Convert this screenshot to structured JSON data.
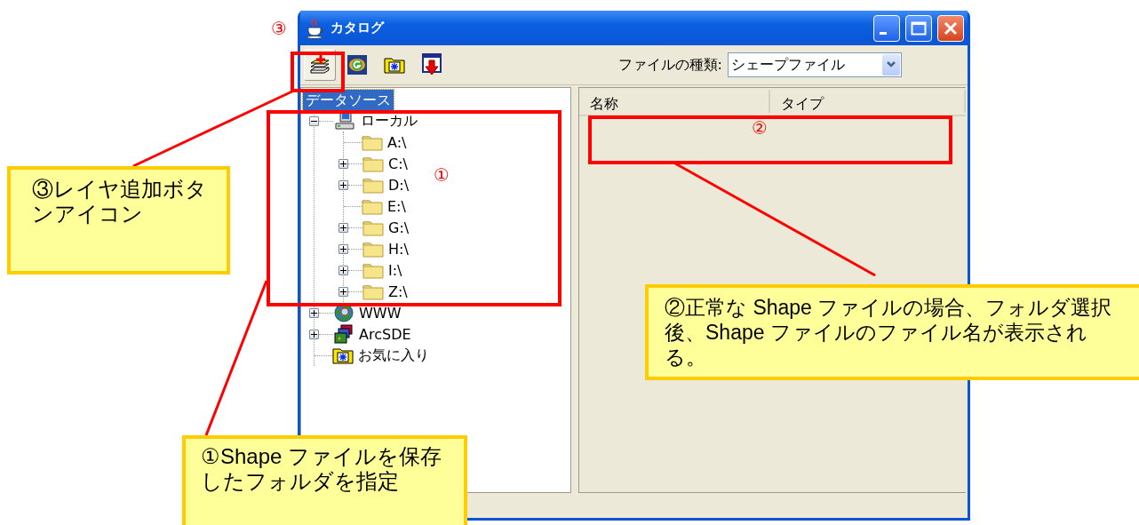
{
  "window": {
    "title": "カタログ"
  },
  "toolbar": {
    "buttons": [
      {
        "kind": "addlayer",
        "selected": true
      },
      {
        "kind": "web",
        "selected": false
      },
      {
        "kind": "favorite",
        "selected": false
      },
      {
        "kind": "export",
        "selected": false
      }
    ],
    "file_type_label": "ファイルの種類:",
    "file_type_value": "シェープファイル"
  },
  "tree": {
    "root": {
      "label": "データソース",
      "selected": true,
      "children": [
        {
          "label": "ローカル",
          "kind": "computer",
          "expanded": true,
          "children": [
            {
              "label": "A:\\",
              "kind": "folder"
            },
            {
              "label": "C:\\",
              "kind": "folder",
              "expanded": false
            },
            {
              "label": "D:\\",
              "kind": "folder",
              "expanded": false
            },
            {
              "label": "E:\\",
              "kind": "folder"
            },
            {
              "label": "G:\\",
              "kind": "folder",
              "expanded": false
            },
            {
              "label": "H:\\",
              "kind": "folder",
              "expanded": false
            },
            {
              "label": "I:\\",
              "kind": "folder",
              "expanded": false
            },
            {
              "label": "Z:\\",
              "kind": "folder",
              "expanded": false
            }
          ]
        },
        {
          "label": "WWW",
          "kind": "globe",
          "expanded": false
        },
        {
          "label": "ArcSDE",
          "kind": "database",
          "expanded": false
        },
        {
          "label": "お気に入り",
          "kind": "favorites"
        }
      ]
    }
  },
  "list": {
    "columns": [
      "名称",
      "タイプ"
    ]
  },
  "annotations": {
    "markers": [
      {
        "label": "③"
      },
      {
        "label": "①"
      },
      {
        "label": "②"
      }
    ],
    "callouts": [
      {
        "text": "③レイヤ追加ボタンアイコン"
      },
      {
        "text": "②正常な Shape ファイルの場合、フォルダ選択後、Shape ファイルのファイル名が表示される。"
      },
      {
        "text": "①Shape ファイルを保存したフォルダを指定"
      }
    ]
  }
}
